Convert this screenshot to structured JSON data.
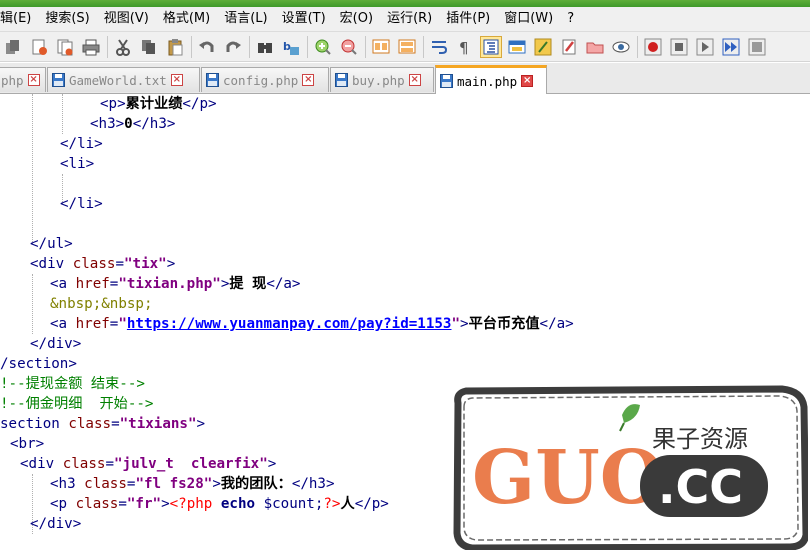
{
  "menu": {
    "items": [
      "辑(E)",
      "搜索(S)",
      "视图(V)",
      "格式(M)",
      "语言(L)",
      "设置(T)",
      "宏(O)",
      "运行(R)",
      "插件(P)",
      "窗口(W)",
      "?"
    ]
  },
  "tabs": [
    {
      "label": "php",
      "active": false
    },
    {
      "label": "GameWorld.txt",
      "active": false
    },
    {
      "label": "config.php",
      "active": false
    },
    {
      "label": "buy.php",
      "active": false
    },
    {
      "label": "main.php",
      "active": true
    }
  ],
  "code": {
    "l1": {
      "open": "<p>",
      "text": "累计业绩",
      "close": "</p>"
    },
    "l2": {
      "open": "<h3>",
      "text": "0",
      "close": "</h3>"
    },
    "l3": {
      "text": "</li>"
    },
    "l4": {
      "text": "<li>"
    },
    "l6": {
      "text": "</li>"
    },
    "l8": {
      "text": "</ul>"
    },
    "l9": {
      "tag_open": "<div ",
      "attr": "class",
      "eq": "=",
      "val": "\"tix\"",
      "gt": ">"
    },
    "l10": {
      "tag_open": "<a ",
      "attr": "href",
      "eq": "=",
      "val": "\"tixian.php\"",
      "gt": ">",
      "text": "提 现",
      "close": "</a>"
    },
    "l11": {
      "text": "&nbsp;&nbsp;"
    },
    "l12": {
      "tag_open": "<a ",
      "attr": "href",
      "eq": "=",
      "q1": "\"",
      "url": "https://www.yuanmanpay.com/pay?id=1153",
      "q2": "\"",
      "gt": ">",
      "text": "平台币充值",
      "close": "</a>"
    },
    "l13": {
      "text": "</div>"
    },
    "l14": {
      "text": "/section>"
    },
    "l15": {
      "text": "!--提现金额 结束-->"
    },
    "l16": {
      "text": "!--佣金明细  开始-->"
    },
    "l17": {
      "tag_open": "section ",
      "attr": "class",
      "eq": "=",
      "val": "\"tixians\"",
      "gt": ">"
    },
    "l18": {
      "text": "<br>"
    },
    "l19": {
      "tag_open": "<div ",
      "attr": "class",
      "eq": "=",
      "val": "\"julv_t  clearfix\"",
      "gt": ">"
    },
    "l20": {
      "tag_open": "<h3 ",
      "attr": "class",
      "eq": "=",
      "val": "\"fl fs28\"",
      "gt": ">",
      "text": "我的团队：",
      "close": "</h3>"
    },
    "l21": {
      "tag_open": "<p ",
      "attr": "class",
      "eq": "=",
      "val": "\"fr\"",
      "gt": ">",
      "php_open": "<?php",
      "kw": "echo",
      "var": "$count;",
      "php_close": "?>",
      "text": "人",
      "close": "</p>"
    },
    "l22": {
      "text": "</div>"
    }
  },
  "watermark": {
    "brand": "GUO",
    "domain": ".CC",
    "cn": "果子资源"
  },
  "colors": {
    "tab_accent": "#f5a623",
    "tag": "#000080",
    "attr": "#800000",
    "attr_value": "#800080",
    "comment": "#008000",
    "php": "#ff0000",
    "watermark_orange": "#e8703a"
  }
}
